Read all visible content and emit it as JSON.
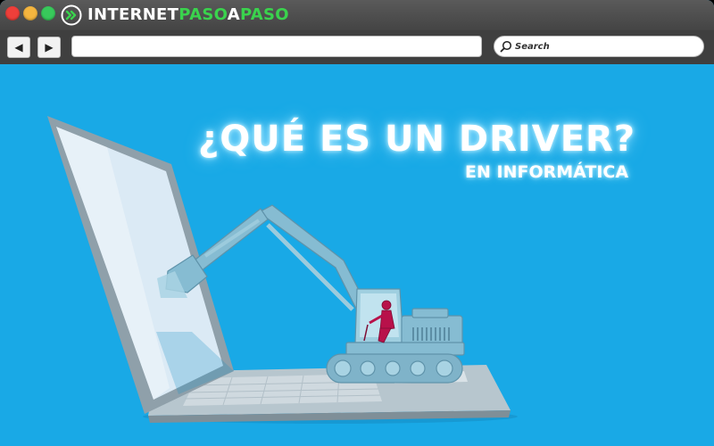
{
  "window": {
    "brand": {
      "word1": "INTERNET",
      "word2": "PASO",
      "word3": "A",
      "word4": "PASO"
    },
    "controls": [
      "close",
      "minimize",
      "maximize"
    ]
  },
  "toolbar": {
    "back_label": "◀",
    "forward_label": "▶",
    "url_value": "",
    "search_placeholder": "Search"
  },
  "article": {
    "headline": "¿QUÉ ES UN DRIVER?",
    "subheadline": "EN INFORMÁTICA"
  },
  "colors": {
    "background": "#19a9e6",
    "titlebar": "#4a4a4a",
    "brand_green": "#3ad34d",
    "excavator": "#86bcd2",
    "operator": "#b8114a"
  },
  "icons": [
    "close-icon",
    "minimize-icon",
    "maximize-icon",
    "brand-logo-icon",
    "back-arrow-icon",
    "forward-arrow-icon",
    "search-icon"
  ]
}
